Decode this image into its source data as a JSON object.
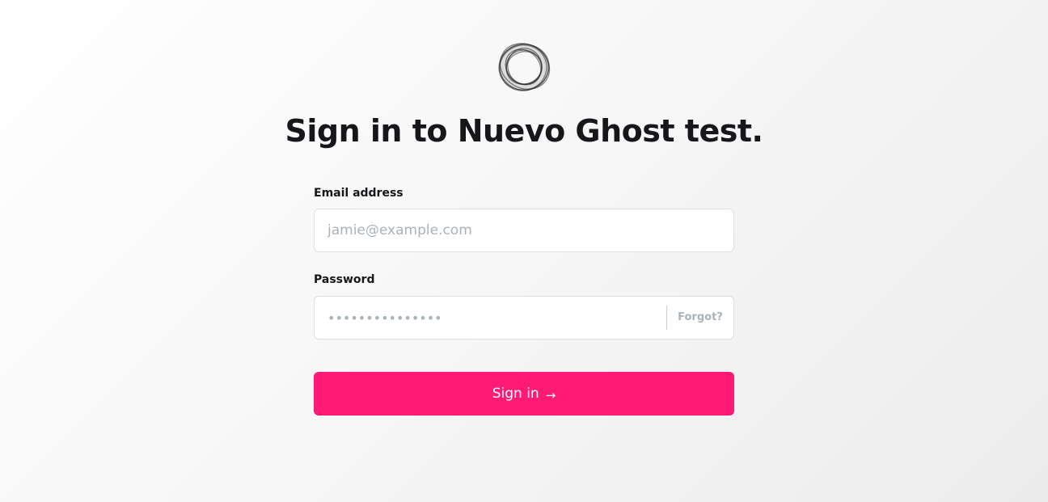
{
  "logo": {
    "icon": "ghost-ring-logo-icon",
    "stroke_color": "#222222"
  },
  "title": "Sign in to Nuevo Ghost test.",
  "form": {
    "email": {
      "label": "Email address",
      "placeholder": "jamie@example.com",
      "value": ""
    },
    "password": {
      "label": "Password",
      "placeholder": "•••••••••••••••",
      "value": "",
      "forgot_label": "Forgot?"
    },
    "submit": {
      "label": "Sign in",
      "arrow": "→"
    }
  },
  "colors": {
    "accent": "#ff1a75",
    "muted_text": "#aab2bb",
    "heading": "#15171a",
    "border": "#dcdfe3"
  }
}
